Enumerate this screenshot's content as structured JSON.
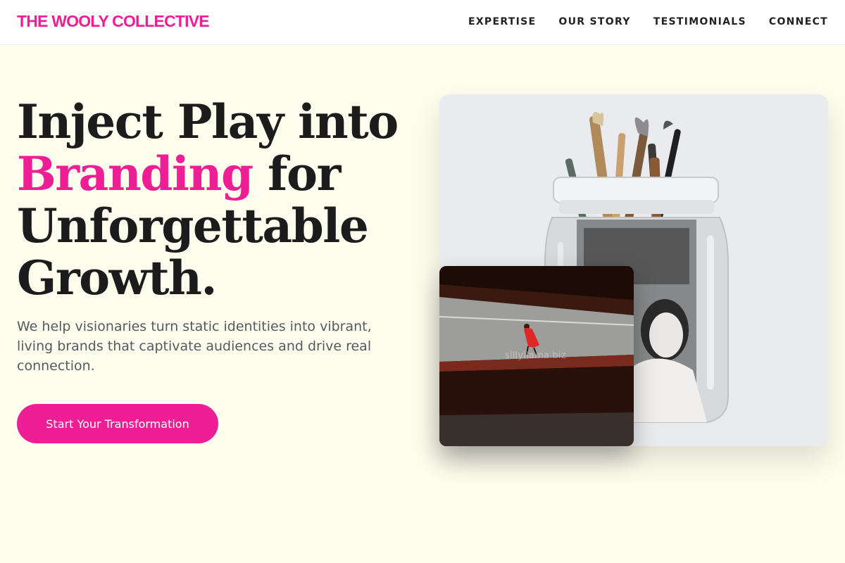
{
  "brand": {
    "name": "THE WOOLY COLLECTIVE",
    "color": "#ee1f94"
  },
  "nav": {
    "items": [
      {
        "label": "EXPERTISE"
      },
      {
        "label": "OUR STORY"
      },
      {
        "label": "TESTIMONIALS"
      },
      {
        "label": "CONNECT"
      }
    ]
  },
  "hero": {
    "headline_part1": "Inject Play into",
    "headline_accent": "Branding",
    "headline_part2": " for Unforgettable Growth.",
    "subtext": "We help visionaries turn static identities into vibrant, living brands that captivate audiences and drive real connection.",
    "cta_label": "Start Your Transformation"
  },
  "images": {
    "main": {
      "subject": "paintbrushes in a glass jar with a black-and-white portrait"
    },
    "secondary": {
      "subject": "figure in red on a staircase",
      "watermark": "sillyllama.biz"
    }
  },
  "colors": {
    "accent": "#ee1f94",
    "background": "#fdfdee",
    "header_bg": "#ffffff",
    "text_dark": "#1c1c1c",
    "text_muted": "#555a5e"
  }
}
